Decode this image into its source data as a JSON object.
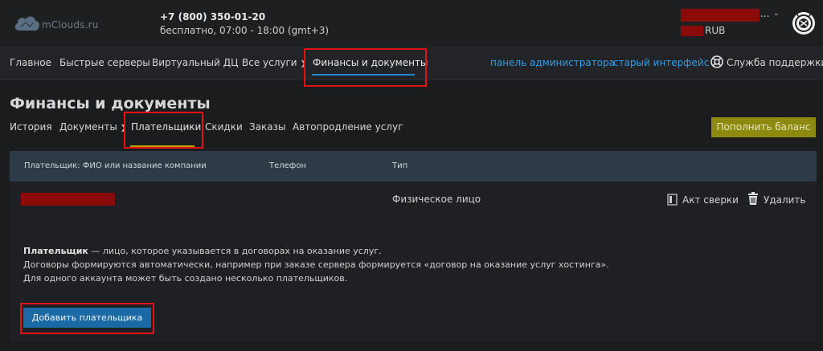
{
  "header": {
    "logo_text": "mClouds.ru",
    "phone": "+7 (800) 350-01-20",
    "hours": "бесплатно, 07:00 - 18:00 (gmt+3)",
    "account_dots": "...",
    "currency": "RUB"
  },
  "nav": {
    "items": [
      "Главное",
      "Быстрые серверы",
      "Виртуальный ДЦ",
      "Все услуги",
      "Финансы и документы"
    ],
    "active": "Финансы и документы",
    "links": [
      "панель администратора",
      "старый интерфейс"
    ],
    "support": "Служба поддержки"
  },
  "page": {
    "title": "Финансы и документы",
    "tabs": [
      "История",
      "Документы",
      "Плательщики",
      "Скидки",
      "Заказы",
      "Автопродление услуг"
    ],
    "active_tab": "Плательщики",
    "topup_label": "Пополнить баланс"
  },
  "table": {
    "columns": [
      "Плательщик: ФИО или название компании",
      "Телефон",
      "Тип"
    ],
    "rows": [
      {
        "type": "Физическое лицо",
        "act_label": "Акт сверки",
        "delete_label": "Удалить"
      }
    ]
  },
  "info": {
    "term": "Плательщик",
    "line1_rest": " — лицо, которое указывается в договорах на оказание услуг.",
    "line2": "Договоры формируются автоматически, например при заказе сервера формируется «договор на оказание услуг хостинга».",
    "line3": "Для одного аккаунта может быть создано несколько плательщиков."
  },
  "add_payer_label": "Добавить плательщика",
  "colors": {
    "accent_blue": "#1f8bd2",
    "button_yellow": "#8e8a10",
    "highlight_red": "#e41313",
    "redaction": "#8b0a0a"
  }
}
